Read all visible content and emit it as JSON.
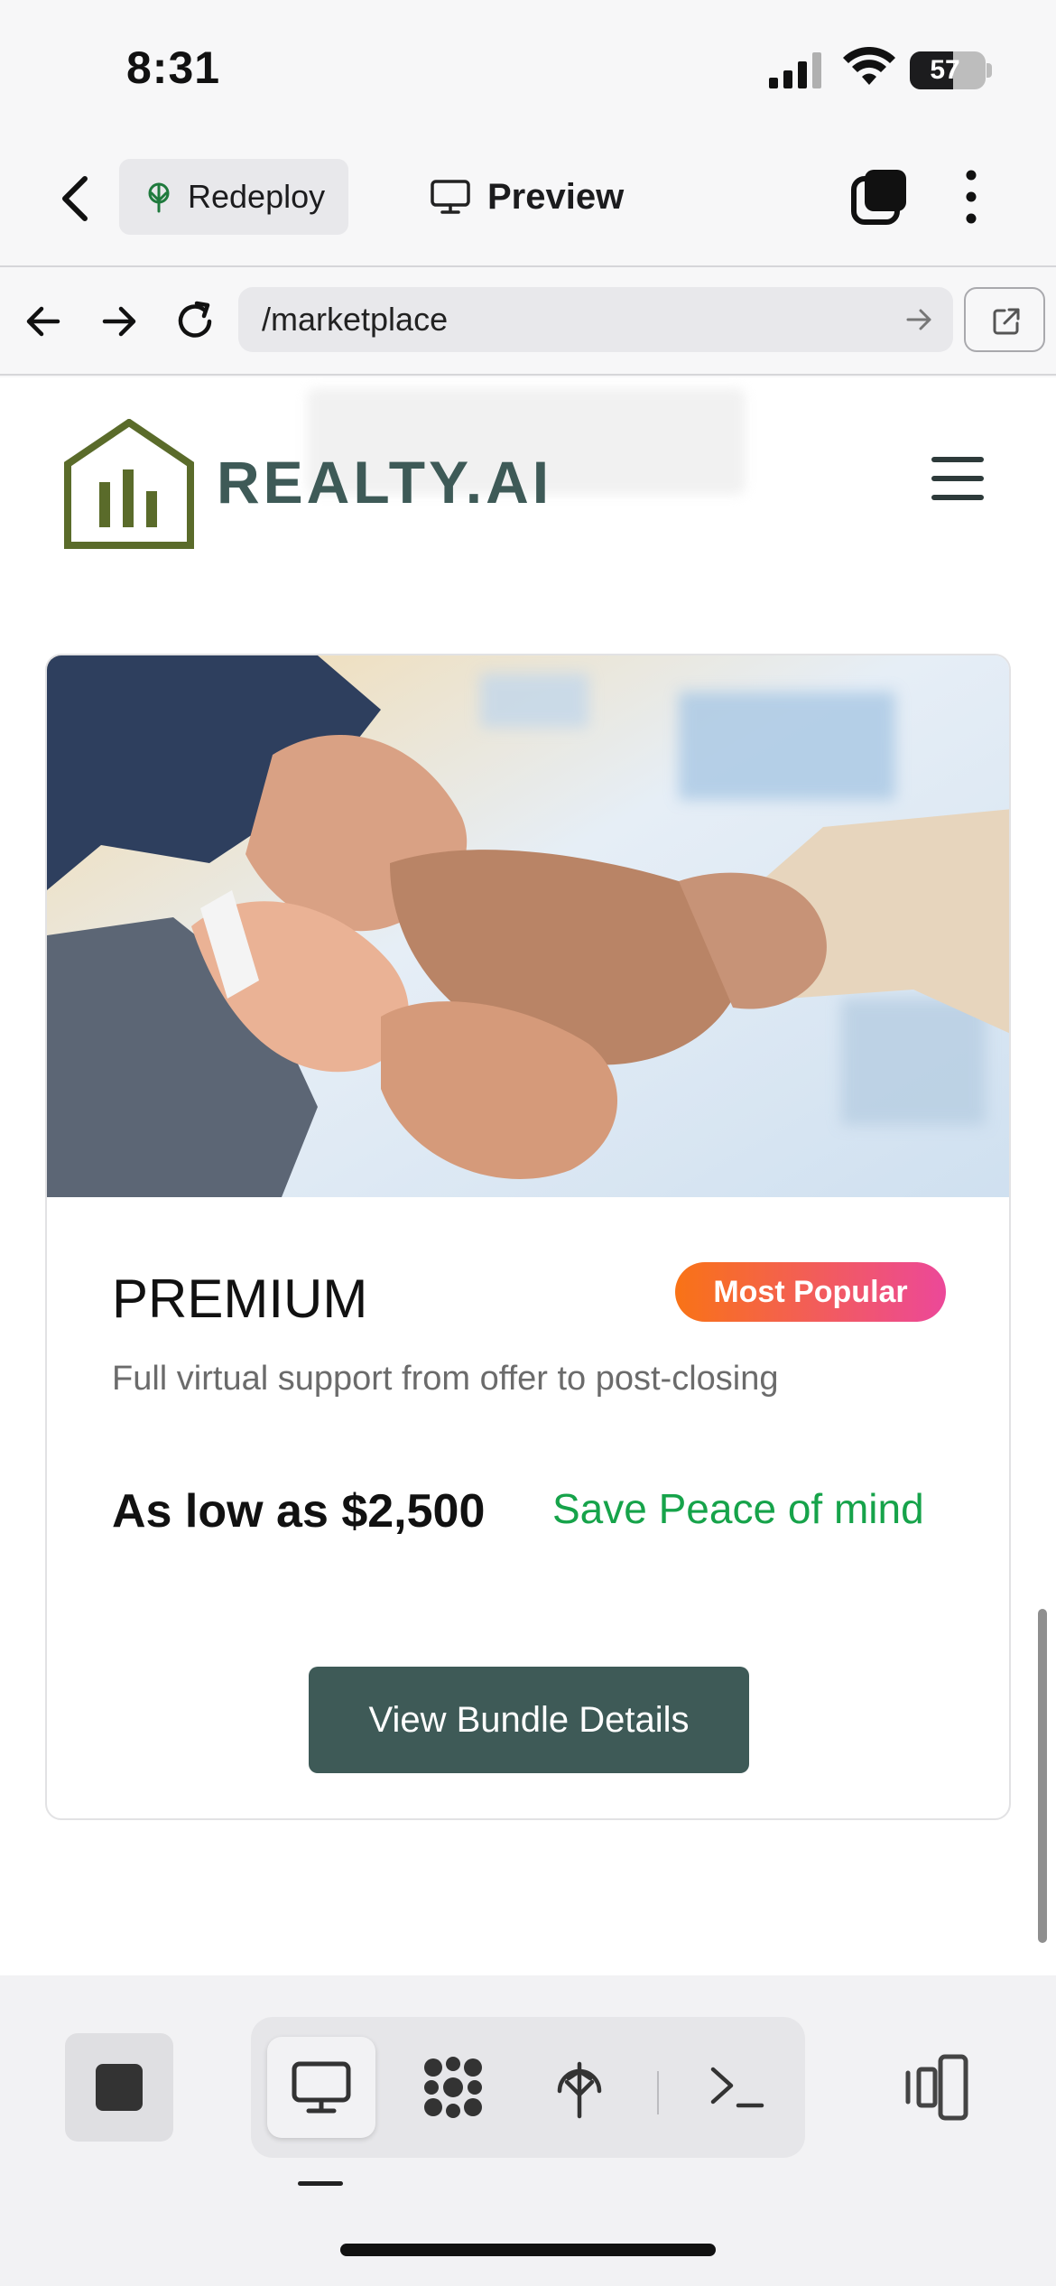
{
  "status_bar": {
    "time": "8:31",
    "battery": "57",
    "battery_level": 0.57
  },
  "app_bar": {
    "redeploy_label": "Redeploy",
    "preview_label": "Preview"
  },
  "url_bar": {
    "path": "/marketplace"
  },
  "site": {
    "logo_text": "REALTY.AI"
  },
  "bundle_card": {
    "tier": "PREMIUM",
    "badge": "Most Popular",
    "description": "Full virtual support from offer to post-closing",
    "price": "As low as $2,500",
    "savings": "Save Peace of mind",
    "cta_label": "View Bundle Details"
  },
  "toolbar": {
    "tools": [
      "monitor-icon",
      "apps-icon",
      "deploy-icon",
      "terminal-icon"
    ],
    "active_tool": "monitor-icon"
  },
  "colors": {
    "brand_green": "#3e5a57",
    "logo_olive": "#5a6b2a",
    "badge_gradient_start": "#f97316",
    "badge_gradient_end": "#ec4899",
    "savings_green": "#16a34a"
  }
}
